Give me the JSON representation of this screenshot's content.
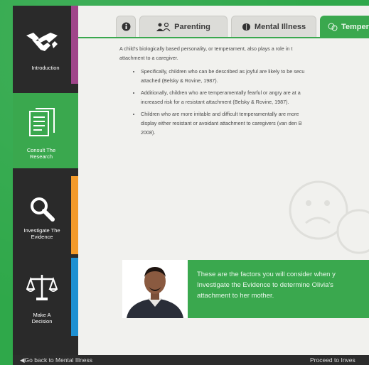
{
  "sidebar": {
    "items": [
      {
        "label": "Introduction",
        "accent": "#a0458a"
      },
      {
        "label": "Consult The Research",
        "accent": "#3aa84e"
      },
      {
        "label": "Investigate The Evidence",
        "accent": "#f39a2a"
      },
      {
        "label": "Make A Decision",
        "accent": "#1e90d2"
      }
    ]
  },
  "tabs": [
    {
      "label": "",
      "icon": "info-icon"
    },
    {
      "label": "Parenting",
      "icon": "people-icon"
    },
    {
      "label": "Mental Illness",
      "icon": "brain-icon"
    },
    {
      "label": "Temper",
      "icon": "faces-icon"
    }
  ],
  "content": {
    "intro_line1": "A child's biologically based personality, or temperament, also plays a role in t",
    "intro_line2": "attachment to a caregiver.",
    "bullets": [
      [
        "Specifically, children who can be described as joyful are likely to be secu",
        "attached (Belsky & Rovine, 1987)."
      ],
      [
        "Additionally, children who are temperamentally fearful or angry are at a",
        "increased risk for a resistant attachment (Belsky & Rovine, 1987)."
      ],
      [
        "Children who are more irritable and difficult temperamentally are more",
        "display either resistant or avoidant attachment to caregivers (van den B",
        "2008)."
      ]
    ]
  },
  "callout": {
    "line1": "These are the factors you will consider when y",
    "line2": "Investigate the Evidence to determine Olivia's",
    "line3": "attachment to her mother."
  },
  "footer": {
    "back_label": "Go back to Mental Illness",
    "forward_label": "Proceed to Inves"
  },
  "colors": {
    "accent_green": "#3aa84e",
    "sidebar_bg": "#2a2a2a"
  }
}
